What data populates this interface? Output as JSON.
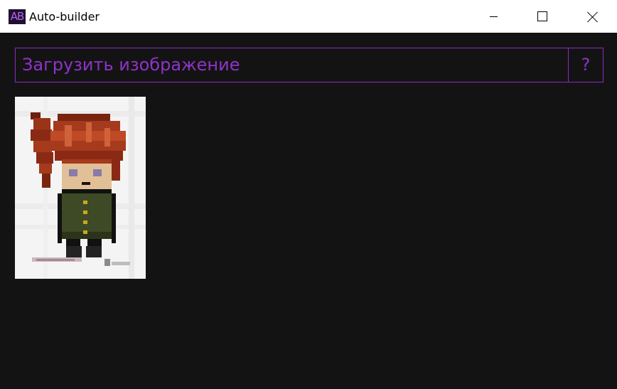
{
  "window": {
    "icon_text": "AB",
    "title": "Auto-builder",
    "controls": [
      "minimize",
      "maximize",
      "close"
    ]
  },
  "toolbar": {
    "load_label": "Загрузить изображение",
    "help_label": "?"
  },
  "colors": {
    "accent": "#8e33c9",
    "background": "#141314",
    "titlebar": "#ffffff"
  },
  "thumbnail": {
    "icon": "pixel-art-character"
  }
}
